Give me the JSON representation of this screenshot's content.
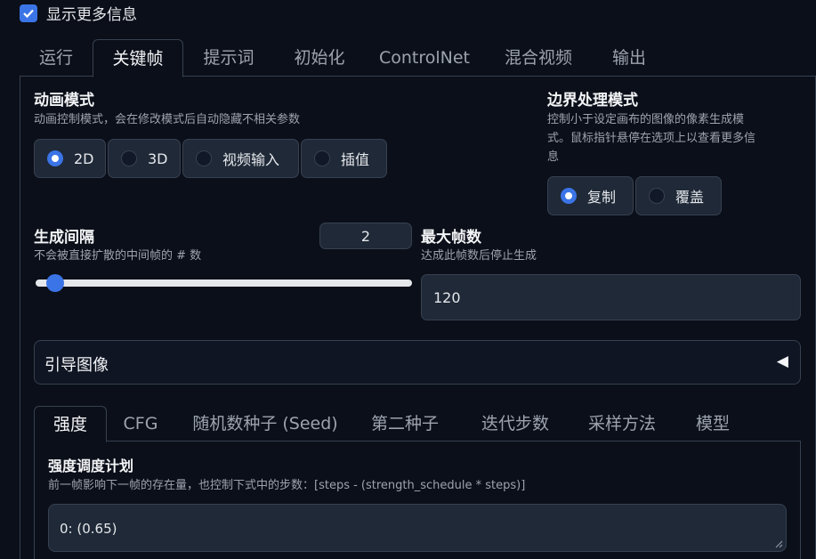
{
  "show_more_info": {
    "label": "显示更多信息",
    "checked": true
  },
  "main_tabs": [
    {
      "label": "运行",
      "active": false
    },
    {
      "label": "关键帧",
      "active": true
    },
    {
      "label": "提示词",
      "active": false
    },
    {
      "label": "初始化",
      "active": false
    },
    {
      "label": "ControlNet",
      "active": false
    },
    {
      "label": "混合视频",
      "active": false
    },
    {
      "label": "输出",
      "active": false
    }
  ],
  "animation_mode": {
    "title": "动画模式",
    "info": "动画控制模式，会在修改模式后自动隐藏不相关参数",
    "options": [
      "2D",
      "3D",
      "视频输入",
      "插值"
    ],
    "selected": "2D"
  },
  "border_mode": {
    "title": "边界处理模式",
    "info_line1": "控制小于设定画布的图像的像素生成模",
    "info_line2": "式。鼠标指针悬停在选项上以查看更多信",
    "info_line3": "息",
    "options": [
      "复制",
      "覆盖"
    ],
    "selected": "复制"
  },
  "cadence": {
    "title": "生成间隔",
    "info": "不会被直接扩散的中间帧的 # 数",
    "value": "2",
    "slider_fraction": 0.03
  },
  "max_frames": {
    "title": "最大帧数",
    "info": "达成此帧数后停止生成",
    "value": "120"
  },
  "guided_images": {
    "title": "引导图像",
    "arrow": "◀"
  },
  "sub_tabs": [
    {
      "label": "强度",
      "active": true
    },
    {
      "label": "CFG",
      "active": false
    },
    {
      "label": "随机数种子 (Seed)",
      "active": false
    },
    {
      "label": "第二种子",
      "active": false
    },
    {
      "label": "迭代步数",
      "active": false
    },
    {
      "label": "采样方法",
      "active": false
    },
    {
      "label": "模型",
      "active": false
    }
  ],
  "strength_schedule": {
    "title": "强度调度计划",
    "info": "前一帧影响下一帧的存在量，也控制下式中的步数：[steps - (strength_schedule * steps)]",
    "value": "0: (0.65)"
  },
  "colors": {
    "accent": "#3b74e6",
    "background": "#0b0f19",
    "input_bg": "#1f2937",
    "border": "#374151"
  }
}
